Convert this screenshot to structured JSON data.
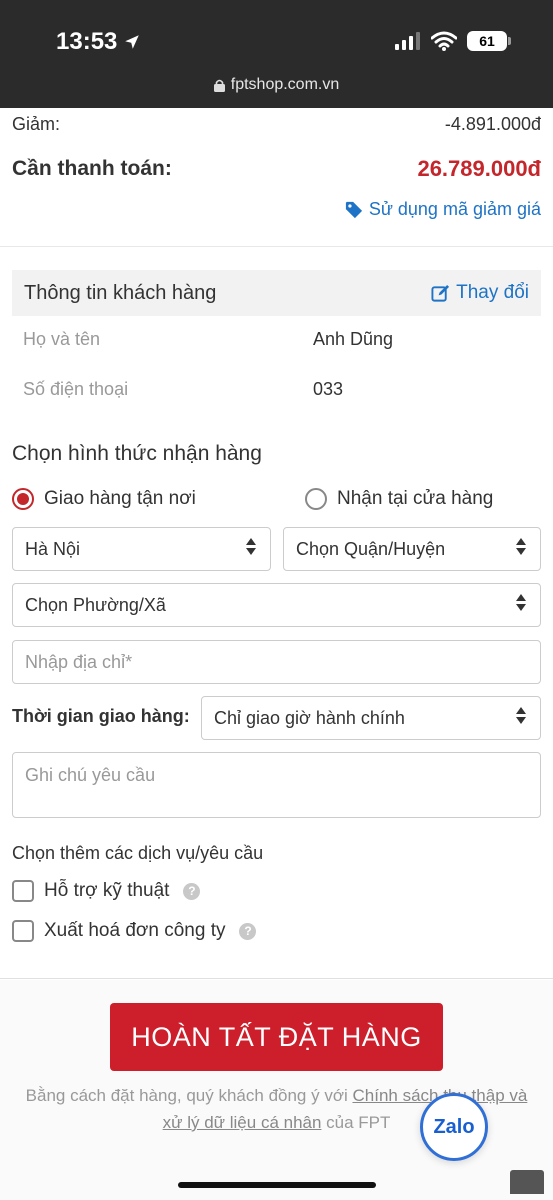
{
  "status_bar": {
    "time": "13:53",
    "battery": "61",
    "url": "fptshop.com.vn"
  },
  "summary": {
    "discount_label": "Giảm:",
    "discount_value": "-4.891.000đ",
    "total_label": "Cần thanh toán:",
    "total_value": "26.789.000đ",
    "coupon_link": "Sử dụng mã giảm giá"
  },
  "customer": {
    "title": "Thông tin khách hàng",
    "edit_label": "Thay đổi",
    "name_label": "Họ và tên",
    "name_value": "Anh Dũng",
    "phone_label": "Số điện thoại",
    "phone_value": "033"
  },
  "delivery": {
    "section_title": "Chọn hình thức nhận hàng",
    "option_home": "Giao hàng tận nơi",
    "option_store": "Nhận tại cửa hàng",
    "selected": "home",
    "city": "Hà Nội",
    "district": "Chọn Quận/Huyện",
    "ward": "Chọn Phường/Xã",
    "address_placeholder": "Nhập địa chỉ*",
    "time_label": "Thời gian giao hàng:",
    "time_value": "Chỉ giao giờ hành chính",
    "note_placeholder": "Ghi chú yêu cầu"
  },
  "services": {
    "title": "Chọn thêm các dịch vụ/yêu cầu",
    "tech_support": "Hỗ trợ kỹ thuật",
    "company_invoice": "Xuất hoá đơn công ty"
  },
  "footer": {
    "order_button": "HOÀN TẤT ĐẶT HÀNG",
    "terms_prefix": "Bằng cách đặt hàng, quý khách đồng ý với ",
    "terms_link": "Chính sách thu thập và xử lý dữ liệu cá nhân",
    "terms_suffix": " của FPT",
    "zalo_label": "Zalo"
  },
  "colors": {
    "accent_red": "#cd1f2b",
    "link_blue": "#1e73c6",
    "price_red": "#c3262b"
  }
}
